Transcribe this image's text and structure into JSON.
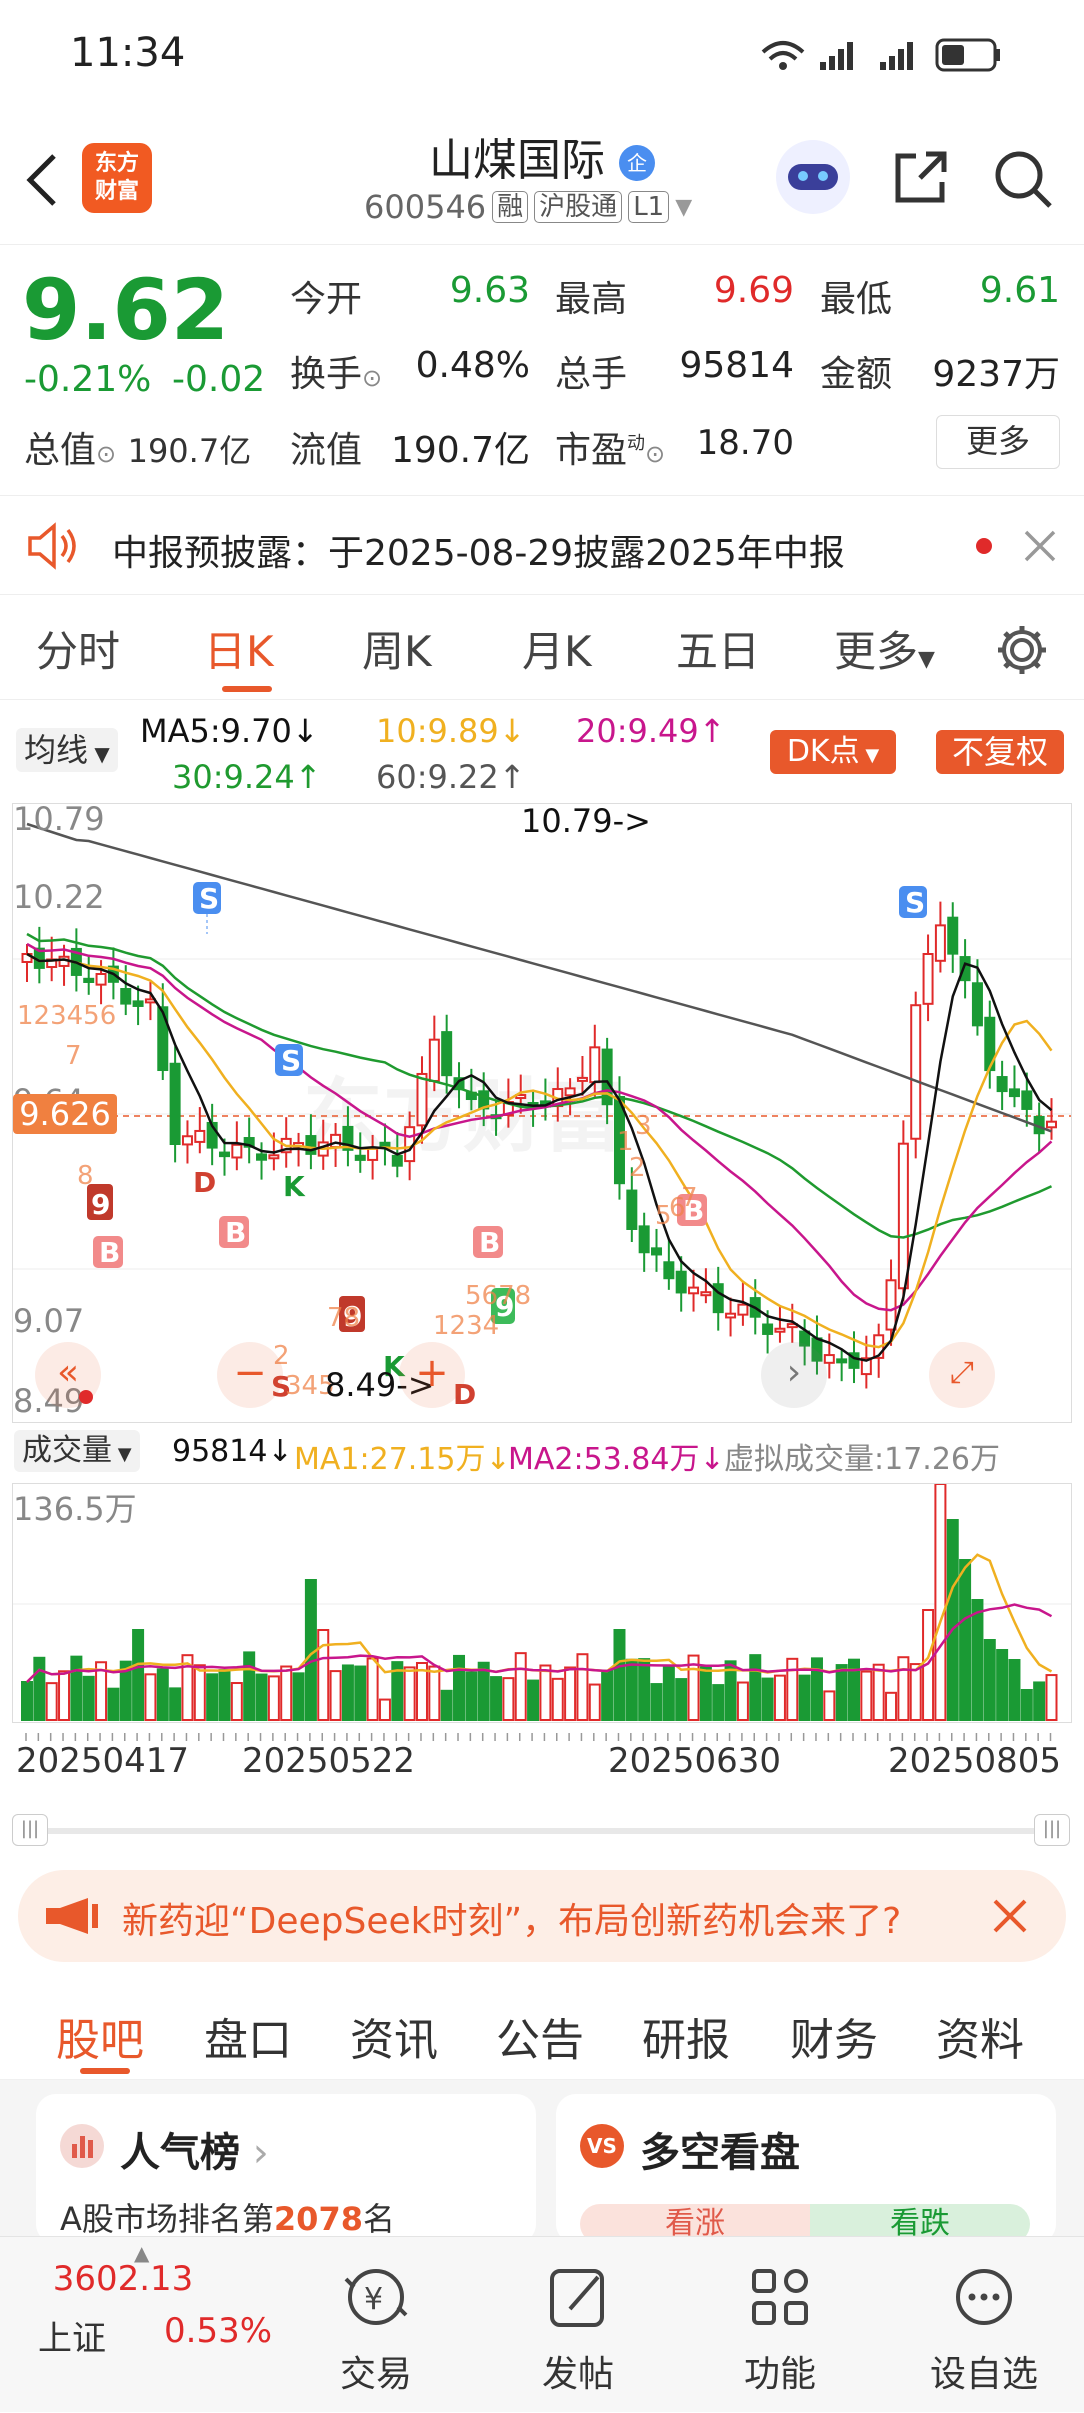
{
  "status_bar": {
    "time": "11:34"
  },
  "header": {
    "name": "山煤国际",
    "code": "600546",
    "tags": [
      "融",
      "沪股通",
      "L1"
    ],
    "company_badge": "企",
    "logo_line1": "东方",
    "logo_line2": "财富"
  },
  "quote": {
    "price": "9.62",
    "change_pct": "-0.21%",
    "change": "-0.02",
    "open_label": "今开",
    "open": "9.63",
    "high_label": "最高",
    "high": "9.69",
    "low_label": "最低",
    "low": "9.61",
    "turnover_label": "换手",
    "turnover": "0.48%",
    "volume_label": "总手",
    "volume": "95814",
    "amount_label": "金额",
    "amount": "9237万",
    "mktcap_label": "总值",
    "mktcap": "190.7亿",
    "float_label": "流值",
    "float": "190.7亿",
    "pe_label": "市盈",
    "pe_sup": "动",
    "pe": "18.70",
    "more": "更多"
  },
  "notice": {
    "text": "中报预披露：于2025-08-29披露2025年中报"
  },
  "tabs": [
    "分时",
    "日K",
    "周K",
    "月K",
    "五日",
    "更多"
  ],
  "active_tab": "日K",
  "ma": {
    "selector": "均线",
    "ma5": "MA5:9.70",
    "ma10": "10:9.89",
    "ma20": "20:9.49",
    "ma30": "30:9.24",
    "ma60": "60:9.22",
    "dk": "DK点",
    "fq": "不复权"
  },
  "chart": {
    "price_labels": [
      "10.79",
      "10.22",
      "9.64",
      "9.07",
      "8.49"
    ],
    "current_tag": "9.626",
    "high_annot": "10.79->",
    "low_annot": "8.49->"
  },
  "volume": {
    "selector": "成交量",
    "vol": "95814",
    "ma1": "MA1:27.15万",
    "ma2": "MA2:53.84万",
    "virtual": "虚拟成交量:17.26万",
    "max": "136.5万"
  },
  "dates": [
    "20250417",
    "20250522",
    "20250630",
    "20250805"
  ],
  "banner": {
    "text": "新药迎“DeepSeek时刻”，布局创新药机会来了?"
  },
  "subtabs": [
    "股吧",
    "盘口",
    "资讯",
    "公告",
    "研报",
    "财务",
    "资料"
  ],
  "cards": {
    "left_title": "人气榜",
    "left_text_pre": "A股市场排名第",
    "left_rank": "2078",
    "left_text_post": "名",
    "right_title": "多空看盘",
    "bull": "看涨",
    "bear": "看跌"
  },
  "bottom": {
    "index_value": "3602.13",
    "index_name": "上证",
    "index_pct": "0.53%",
    "items": [
      "交易",
      "发帖",
      "功能",
      "设自选"
    ]
  },
  "colors": {
    "accent": "#e8582b",
    "up": "#e02a2a",
    "down": "#1a9a34",
    "ma5": "#111111",
    "ma10": "#f0b020",
    "ma20": "#c8168c",
    "ma30": "#1f9a2f",
    "ma60": "#555555"
  }
}
